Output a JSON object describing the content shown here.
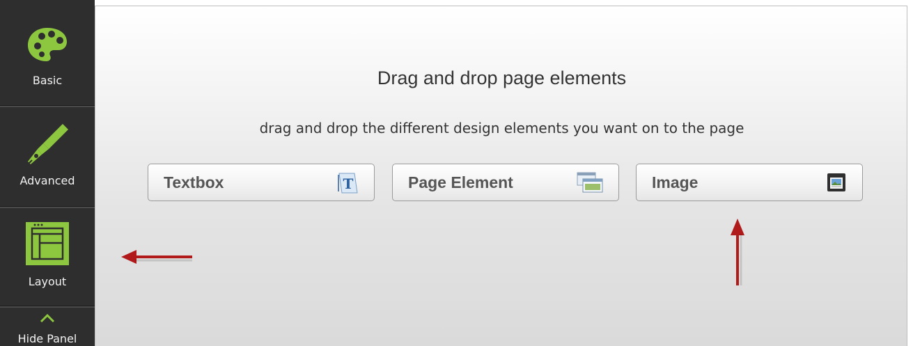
{
  "sidebar": {
    "items": [
      {
        "label": "Basic",
        "icon": "palette-icon"
      },
      {
        "label": "Advanced",
        "icon": "pen-nib-icon"
      },
      {
        "label": "Layout",
        "icon": "layout-icon"
      },
      {
        "label": "Hide Panel",
        "icon": "chevron-up-icon"
      }
    ]
  },
  "main": {
    "title": "Drag and drop page elements",
    "subtitle": "drag and drop the different design elements you want on to the page",
    "elements": [
      {
        "label": "Textbox",
        "icon": "textbox-icon"
      },
      {
        "label": "Page Element",
        "icon": "windows-icon"
      },
      {
        "label": "Image",
        "icon": "image-icon"
      }
    ]
  },
  "colors": {
    "sidebar_bg": "#2e2e2e",
    "accent_green": "#8dc63f",
    "arrow_red": "#b01a1a"
  }
}
